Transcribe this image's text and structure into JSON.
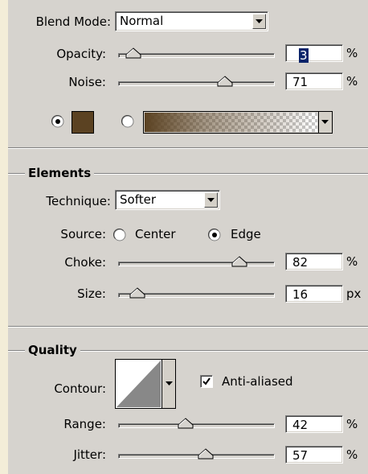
{
  "structure": {
    "blend_mode_label": "Blend Mode:",
    "blend_mode_value": "Normal",
    "opacity_label": "Opacity:",
    "opacity_value": "3",
    "opacity_unit": "%",
    "noise_label": "Noise:",
    "noise_value": "71",
    "noise_unit": "%",
    "color_swatch": "#5b4222",
    "fill_mode": "color"
  },
  "elements": {
    "title": "Elements",
    "technique_label": "Technique:",
    "technique_value": "Softer",
    "source_label": "Source:",
    "source_center": "Center",
    "source_edge": "Edge",
    "source_selected": "Edge",
    "choke_label": "Choke:",
    "choke_value": "82",
    "choke_unit": "%",
    "size_label": "Size:",
    "size_value": "16",
    "size_unit": "px"
  },
  "quality": {
    "title": "Quality",
    "contour_label": "Contour:",
    "antialiased_label": "Anti-aliased",
    "antialiased_checked": true,
    "range_label": "Range:",
    "range_value": "42",
    "range_unit": "%",
    "jitter_label": "Jitter:",
    "jitter_value": "57",
    "jitter_unit": "%"
  },
  "sliders": {
    "opacity": 0.03,
    "noise": 0.71,
    "choke": 0.82,
    "size": 0.06,
    "range": 0.42,
    "jitter": 0.57
  }
}
